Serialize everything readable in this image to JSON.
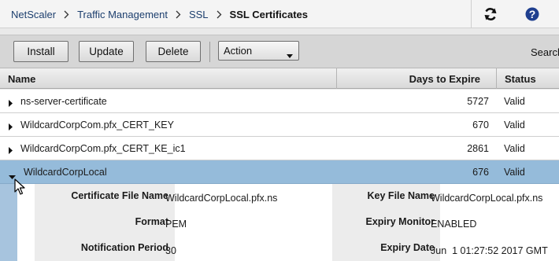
{
  "breadcrumb": {
    "items": [
      "NetScaler",
      "Traffic Management",
      "SSL",
      "SSL Certificates"
    ]
  },
  "topbar_icons": [
    "refresh-icon",
    "help-icon"
  ],
  "toolbar": {
    "install_label": "Install",
    "update_label": "Update",
    "delete_label": "Delete",
    "action_value": "Action",
    "search_label": "Search"
  },
  "table": {
    "columns": [
      "Name",
      "Days to Expire",
      "Status"
    ],
    "rows": [
      {
        "name": "ns-server-certificate",
        "days": "5727",
        "status": "Valid",
        "expanded": false
      },
      {
        "name": "WildcardCorpCom.pfx_CERT_KEY",
        "days": "670",
        "status": "Valid",
        "expanded": false
      },
      {
        "name": "WildcardCorpCom.pfx_CERT_KE_ic1",
        "days": "2861",
        "status": "Valid",
        "expanded": false
      },
      {
        "name": "WildcardCorpLocal",
        "days": "676",
        "status": "Valid",
        "expanded": true
      }
    ]
  },
  "details": {
    "cert_file_label": "Certificate File Name",
    "cert_file_value": "WildcardCorpLocal.pfx.ns",
    "key_file_label": "Key File Name",
    "key_file_value": "WildcardCorpLocal.pfx.ns",
    "format_label": "Format",
    "format_value": "PEM",
    "expiry_monitor_label": "Expiry Monitor",
    "expiry_monitor_value": "ENABLED",
    "notification_label": "Notification Period",
    "notification_value": "30",
    "expiry_date_label": "Expiry Date",
    "expiry_date_value": "Jun  1 01:27:52 2017 GMT"
  },
  "colors": {
    "selected_row": "#95bbda",
    "link": "#1d3f6e",
    "detail_border": "#a7c4de"
  }
}
